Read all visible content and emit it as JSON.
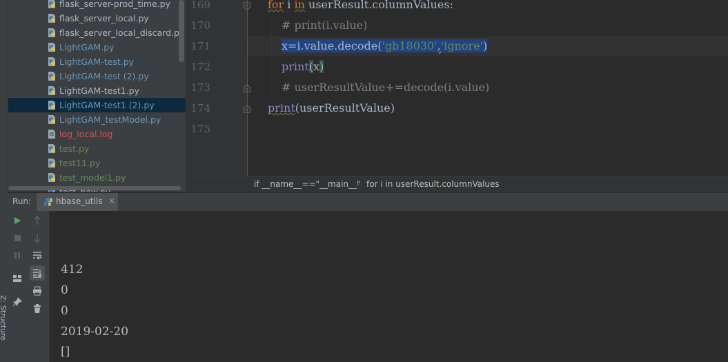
{
  "structure_tab": {
    "label": "Z: Structure"
  },
  "project": {
    "files": [
      {
        "name": "flask_server-prod_time.py",
        "color": "#a9b7c6",
        "type": "python",
        "selected": false
      },
      {
        "name": "flask_server_local.py",
        "color": "#a9b7c6",
        "type": "python",
        "selected": false
      },
      {
        "name": "flask_server_local_discard.py",
        "color": "#a9b7c6",
        "type": "python",
        "selected": false
      },
      {
        "name": "LightGAM.py",
        "color": "#6897bb",
        "type": "python",
        "selected": false
      },
      {
        "name": "LightGAM-test.py",
        "color": "#6897bb",
        "type": "python",
        "selected": false
      },
      {
        "name": "LightGAM-test (2).py",
        "color": "#6897bb",
        "type": "python",
        "selected": false
      },
      {
        "name": "LightGAM-test1.py",
        "color": "#a9b7c6",
        "type": "python",
        "selected": false
      },
      {
        "name": "LightGAM-test1 (2).py",
        "color": "#6897bb",
        "type": "python",
        "selected": true
      },
      {
        "name": "LightGAM_testModel.py",
        "color": "#6897bb",
        "type": "python",
        "selected": false
      },
      {
        "name": "log_local.log",
        "color": "#d25252",
        "type": "log",
        "selected": false
      },
      {
        "name": "test.py",
        "color": "#6a8759",
        "type": "python",
        "selected": false
      },
      {
        "name": "test11.py",
        "color": "#6a8759",
        "type": "python",
        "selected": false
      },
      {
        "name": "test_model1.py",
        "color": "#6a8759",
        "type": "python",
        "selected": false
      },
      {
        "name": "test_new.py",
        "color": "#a9b7c6",
        "type": "python",
        "selected": false
      }
    ]
  },
  "editor": {
    "line_numbers": [
      "169",
      "170",
      "171",
      "172",
      "173",
      "174",
      "175"
    ],
    "line_169": {
      "kw_for": "for",
      "space1": " i ",
      "kw_in": "in",
      "rest": " userResult.columnValues:"
    },
    "line_170": {
      "comment": "# print(i.value)"
    },
    "line_171": {
      "pre": "x=i.value.decode(",
      "s1": "'gb18030'",
      "comma": ",",
      "s2": "'ignore'",
      "post": ")"
    },
    "line_172": {
      "fn": "print",
      "open": "(",
      "arg": "x",
      "close": ")"
    },
    "line_173": {
      "comment": "# userResultValue+=decode(i.value)"
    },
    "line_174": {
      "fn": "print",
      "args": "(userResultValue)"
    }
  },
  "breadcrumb": {
    "item1": "if __name__==\"__main__\"",
    "separator": "›",
    "item2": "for i in userResult.columnValues"
  },
  "run_panel": {
    "label": "Run:",
    "tab_label": "hbase_utils",
    "close_glyph": "×",
    "output_lines": [
      "412",
      "0",
      "0",
      "2019-02-20",
      "[]"
    ]
  },
  "colors": {
    "background": "#2b2b2b",
    "panel": "#3c3f41",
    "selection": "#214283",
    "keyword": "#cc7832",
    "string": "#6a8759",
    "comment": "#808080",
    "builtin": "#8888c6"
  }
}
